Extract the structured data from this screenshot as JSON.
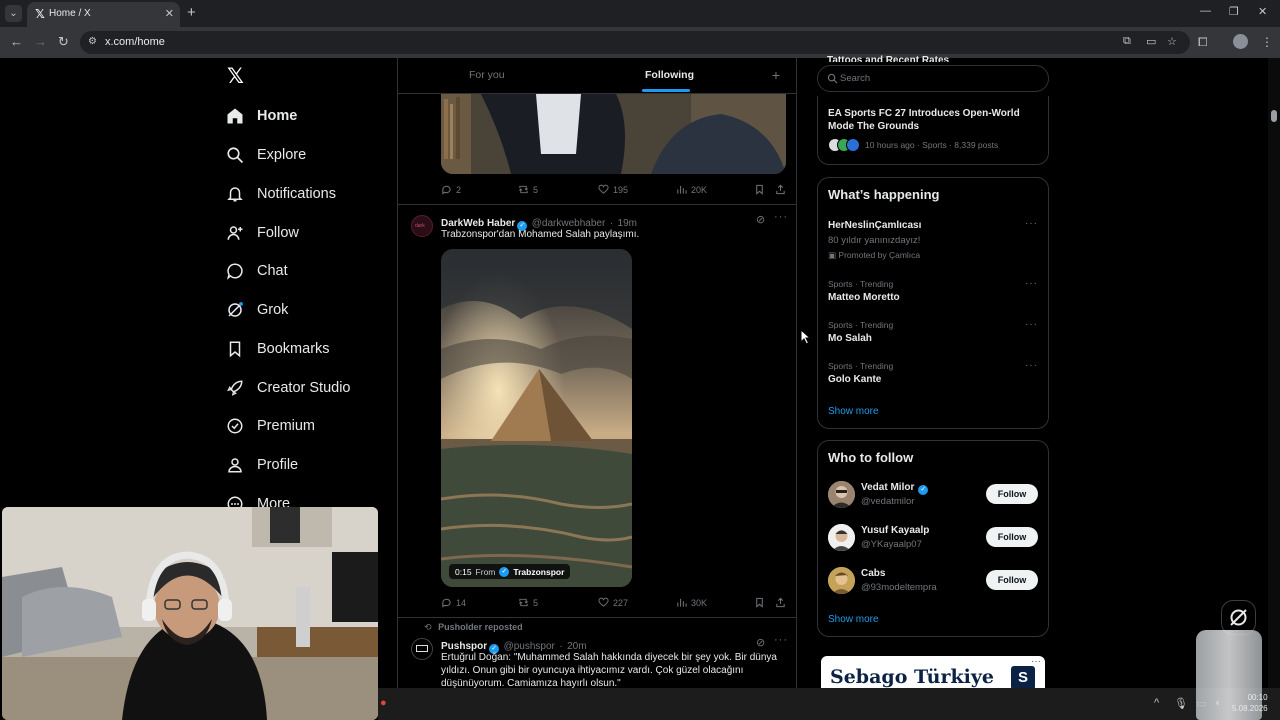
{
  "browser": {
    "tab_title": "Home / X",
    "url": "x.com/home"
  },
  "nav": {
    "items": [
      {
        "label": "Home",
        "icon": "home-icon"
      },
      {
        "label": "Explore",
        "icon": "search-icon"
      },
      {
        "label": "Notifications",
        "icon": "bell-icon"
      },
      {
        "label": "Follow",
        "icon": "person-add-icon"
      },
      {
        "label": "Chat",
        "icon": "chat-icon"
      },
      {
        "label": "Grok",
        "icon": "grok-icon"
      },
      {
        "label": "Bookmarks",
        "icon": "bookmark-icon"
      },
      {
        "label": "Creator Studio",
        "icon": "rocket-icon"
      },
      {
        "label": "Premium",
        "icon": "verified-badge-icon"
      },
      {
        "label": "Profile",
        "icon": "person-icon"
      },
      {
        "label": "More",
        "icon": "more-circle-icon"
      }
    ]
  },
  "feed": {
    "tabs": [
      {
        "label": "For you",
        "active": false
      },
      {
        "label": "Following",
        "active": true
      }
    ],
    "post1": {
      "replies": "2",
      "reposts": "5",
      "likes": "195",
      "views": "20K"
    },
    "post2": {
      "name": "DarkWeb Haber",
      "handle": "@darkwebhaber",
      "time": "19m",
      "text": "Trabzonspor'dan Mohamed Salah paylaşımı.",
      "video_duration": "0:15",
      "video_from_label": "From",
      "video_from": "Trabzonspor",
      "replies": "14",
      "reposts": "5",
      "likes": "227",
      "views": "30K"
    },
    "post3": {
      "repost_note": "Pusholder reposted",
      "name": "Pushspor",
      "handle": "@pushspor",
      "time": "20m",
      "text": "Ertuğrul Doğan: \"Muhammed Salah hakkında diyecek bir şey yok. Bir dünya yıldızı. Onun gibi bir oyuncuya ihtiyacımız vardı. Çok güzel olacağını düşünüyorum. Camiamıza hayırlı olsun.\""
    }
  },
  "right": {
    "search_placeholder": "Search",
    "news_partial_title": "Tattoos and Recent Rates",
    "news": {
      "title": "EA Sports FC 27 Introduces Open-World Mode The Grounds",
      "meta": "10 hours ago · Sports · 8,339 posts"
    },
    "whats_happening": {
      "title": "What’s happening",
      "promo": {
        "name": "HerNeslinÇamlıcası",
        "sub": "80 yıldır yanınızdayız!",
        "promoted": "Promoted by Çamlıca"
      },
      "trends": [
        {
          "meta": "Sports · Trending",
          "name": "Matteo Moretto"
        },
        {
          "meta": "Sports · Trending",
          "name": "Mo Salah"
        },
        {
          "meta": "Sports · Trending",
          "name": "Golo Kante"
        }
      ],
      "show_more": "Show more"
    },
    "who_to_follow": {
      "title": "Who to follow",
      "users": [
        {
          "name": "Vedat Milor",
          "handle": "@vedatmilor",
          "verified": true,
          "button": "Follow"
        },
        {
          "name": "Yusuf Kayaalp",
          "handle": "@YKayaalp07",
          "verified": false,
          "button": "Follow"
        },
        {
          "name": "Cabs",
          "handle": "@93modeltempra",
          "verified": false,
          "button": "Follow"
        }
      ],
      "show_more": "Show more"
    },
    "ad": {
      "text": "Sebago Türkiye",
      "logo": "S"
    }
  },
  "system": {
    "time": "00:10",
    "date": "5.08.2026"
  },
  "colors": {
    "accent": "#1d9bf0",
    "background": "#000000",
    "border": "#2f3336",
    "muted": "#71767b"
  }
}
